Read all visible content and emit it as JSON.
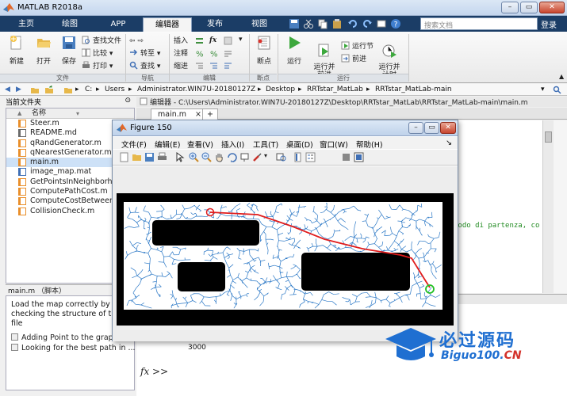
{
  "app": {
    "title": "MATLAB R2018a",
    "window_buttons": [
      "–",
      "▭",
      "✕"
    ]
  },
  "ribbon_tabs": [
    {
      "label": "主页",
      "active": false
    },
    {
      "label": "绘图",
      "active": false
    },
    {
      "label": "APP",
      "active": false
    },
    {
      "label": "编辑器",
      "active": true
    },
    {
      "label": "发布",
      "active": false
    },
    {
      "label": "视图",
      "active": false
    }
  ],
  "search": {
    "placeholder": "搜索文档"
  },
  "login_label": "登录",
  "ribbon": {
    "file": {
      "group": "文件",
      "new": "新建",
      "open": "打开",
      "save": "保存",
      "find_files": "查找文件",
      "compare": "比较",
      "print": "打印"
    },
    "nav": {
      "group": "导航",
      "goto": "转至",
      "find": "查找"
    },
    "edit": {
      "group": "编辑",
      "insert": "插入",
      "comment": "注释",
      "indent": "缩进",
      "fx": "fx"
    },
    "breakpoints": {
      "group": "断点",
      "label": "断点"
    },
    "run": {
      "group": "运行",
      "run": "运行",
      "run_advance": "运行并\n前进",
      "run_section": "运行节",
      "advance": "前进",
      "run_time": "运行并\n计时"
    }
  },
  "address": {
    "crumbs": [
      "C:",
      "Users",
      "Administrator.WIN7U-20180127Z",
      "Desktop",
      "RRTstar_MatLab",
      "RRTstar_MatLab-main"
    ]
  },
  "folder_panel": {
    "title": "当前文件夹",
    "col_name": "名称",
    "sort_mark": "▲",
    "files": [
      {
        "name": "Steer.m",
        "type": "m"
      },
      {
        "name": "README.md",
        "type": "md"
      },
      {
        "name": "qRandGenerator.m",
        "type": "m"
      },
      {
        "name": "qNearestGenerator.m",
        "type": "m"
      },
      {
        "name": "main.m",
        "type": "m",
        "selected": true
      },
      {
        "name": "image_map.mat",
        "type": "mat"
      },
      {
        "name": "GetPointsInNeighborho",
        "type": "m"
      },
      {
        "name": "ComputePathCost.m",
        "type": "m"
      },
      {
        "name": "ComputeCostBetweenTw",
        "type": "m"
      },
      {
        "name": "CollisionCheck.m",
        "type": "m"
      }
    ]
  },
  "details": {
    "title": "main.m （脚本）",
    "description": "Load the map correctly by checking the structure of the file",
    "items": [
      "Adding Point to the graph",
      "Looking for the best path in ..."
    ]
  },
  "editor": {
    "header": "编辑器 - C:\\Users\\Administrator.WIN7U-20180127Z\\Desktop\\RRTstar_MatLab\\RRTstar_MatLab-main\\main.m",
    "tab": "main.m",
    "close": "×",
    "add": "+",
    "code_fragment": "nodo di partenza, co"
  },
  "command": {
    "output": "3000",
    "prompt": "fx >>"
  },
  "figure": {
    "title": "Figure 150",
    "menus": [
      "文件(F)",
      "编辑(E)",
      "查看(V)",
      "插入(I)",
      "工具(T)",
      "桌面(D)",
      "窗口(W)",
      "帮助(H)"
    ],
    "colors": {
      "tree": "#2b78c6",
      "path": "#e11c1c",
      "obstacle": "#000000",
      "goal": "#22c022"
    }
  },
  "watermark": {
    "cn": "必过源码",
    "en_main": "Biguo100.",
    "en_suffix": "CN"
  }
}
